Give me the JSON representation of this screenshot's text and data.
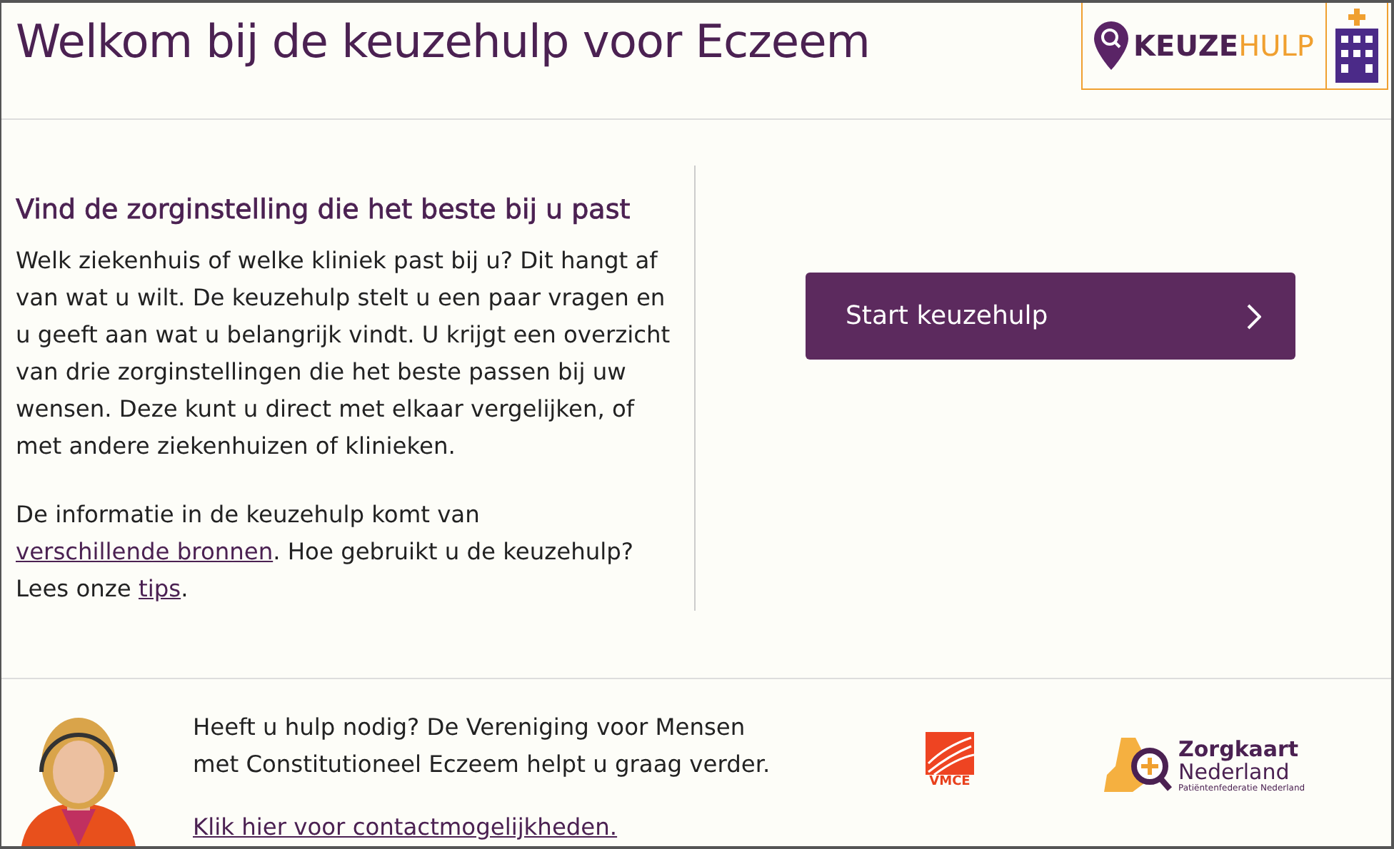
{
  "header": {
    "title": "Welkom bij de keuzehulp voor Eczeem",
    "logo": {
      "part_1": "KEUZE",
      "part_2": "HULP"
    }
  },
  "intro": {
    "heading": "Vind de zorginstelling die het beste bij u past",
    "paragraph": "Welk ziekenhuis of welke kliniek past bij u? Dit hangt af van wat u wilt. De keuzehulp stelt u een paar vragen en u geeft aan wat u belangrijk vindt. U krijgt een overzicht van drie zorginstellingen die het beste passen bij uw wensen. Deze kunt u direct met elkaar vergelijken, of met andere ziekenhuizen of klinieken.",
    "info": [
      {
        "kind": "text",
        "text": "De informatie in de keuzehulp komt van "
      },
      {
        "kind": "link",
        "text": "verschillende bronnen"
      },
      {
        "kind": "text",
        "text": ". Hoe gebruikt u de keuzehulp? Lees onze "
      },
      {
        "kind": "link",
        "text": "tips"
      },
      {
        "kind": "text",
        "text": "."
      }
    ]
  },
  "start_button": {
    "label": "Start keuzehulp"
  },
  "footer": {
    "help_text": "Heeft u hulp nodig? De Vereniging voor Mensen met Constitutioneel Eczeem helpt u graag verder.",
    "contact_link": "Klik hier voor contactmogelijkheden.",
    "vmce_logo": "VMCE",
    "zorgkaart_logo": {
      "line_1": "Zorgkaart",
      "line_2": "Nederland",
      "tagline": "Patiëntenfederatie Nederland"
    }
  }
}
